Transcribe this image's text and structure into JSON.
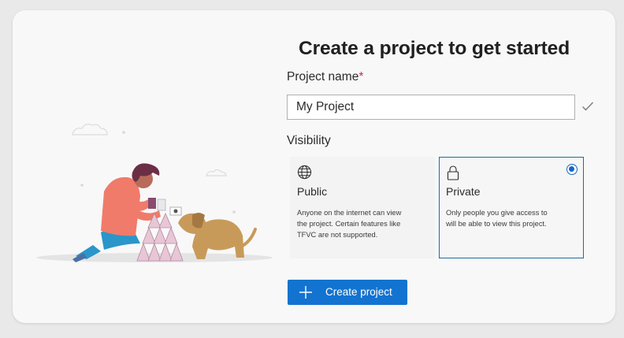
{
  "page": {
    "title": "Create a project to get started"
  },
  "form": {
    "name_label": "Project name",
    "required_marker": "*",
    "name_value": "My Project",
    "visibility_label": "Visibility"
  },
  "visibility_options": [
    {
      "title": "Public",
      "description": "Anyone on the internet can view the project. Certain features like TFVC are not supported.",
      "icon": "globe-icon",
      "selected": false
    },
    {
      "title": "Private",
      "description": "Only people you give access to will be able to view this project.",
      "icon": "lock-icon",
      "selected": true
    }
  ],
  "actions": {
    "create_label": "Create project",
    "create_icon": "plus-icon"
  },
  "colors": {
    "accent": "#1373d0",
    "selected_border": "#1f6d9b",
    "required": "#c4314b"
  }
}
